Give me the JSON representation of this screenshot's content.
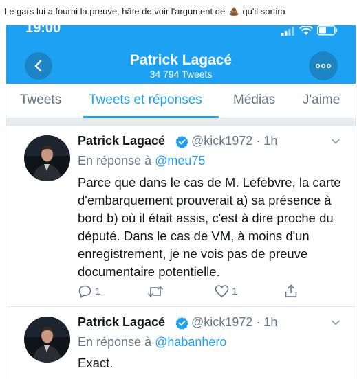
{
  "caption": {
    "before": "Le gars lui a fourni la preuve, hâte de voir l'argument de",
    "emoji": "pile-of-poo-icon",
    "after": "qu'il sortira"
  },
  "status_bar": {
    "time": "19:00"
  },
  "profile_header": {
    "title": "Patrick Lagacé",
    "subtitle": "34 794 Tweets",
    "back_icon": "chevron-left-icon",
    "more_icon": "more-dots-icon"
  },
  "tabs": [
    {
      "label": "Tweets",
      "active": false
    },
    {
      "label": "Tweets et réponses",
      "active": true
    },
    {
      "label": "Médias",
      "active": false
    },
    {
      "label": "J'aime",
      "active": false
    }
  ],
  "tweets": [
    {
      "name": "Patrick Lagacé",
      "handle_time": "@kick1972 · 1h",
      "reply_prefix": "En réponse à",
      "reply_to": "@meu75",
      "text": "Parce que dans le cas de M. Lefebvre, la carte d'embarquement prouverait a) sa présence à bord b) où il était assis, c'est à dire proche du député. Dans le cas de VM, à moins d'un enregistrement, je ne vois pas de preuve documentaire potentielle.",
      "reply_count": "1",
      "like_count": "1"
    },
    {
      "name": "Patrick Lagacé",
      "handle_time": "@kick1972 · 1h",
      "reply_prefix": "En réponse à",
      "reply_to": "@habanhero",
      "text": "Exact."
    }
  ],
  "colors": {
    "accent": "#1da1f2",
    "header_button": "#1c84c5",
    "muted": "#657786",
    "text": "#14171a"
  }
}
